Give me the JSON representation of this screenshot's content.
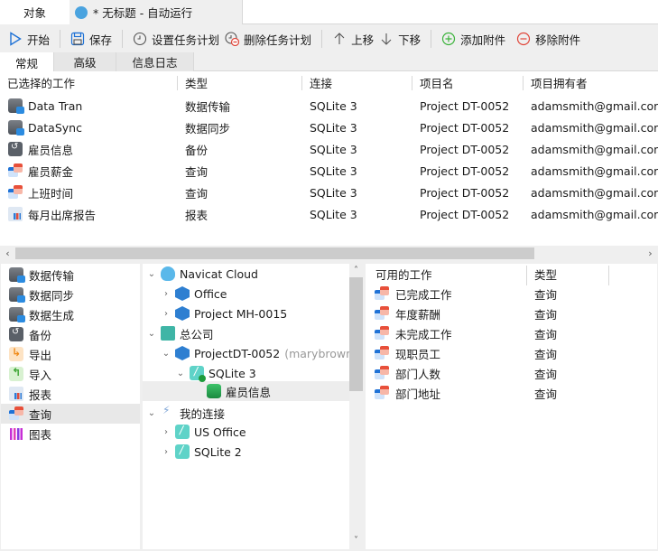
{
  "tabs": {
    "objects": "对象",
    "document": "* 无标题 - 自动运行"
  },
  "toolbar": {
    "start": "开始",
    "save": "保存",
    "set_schedule": "设置任务计划",
    "delete_schedule": "删除任务计划",
    "move_up": "上移",
    "move_down": "下移",
    "add_attachment": "添加附件",
    "remove_attachment": "移除附件"
  },
  "subtabs": [
    "常规",
    "高级",
    "信息日志"
  ],
  "selected_jobs": {
    "columns": [
      "已选择的工作",
      "类型",
      "连接",
      "项目名",
      "项目拥有者"
    ],
    "rows": [
      {
        "icon": "data-transfer-icon",
        "name": "Data Tran",
        "type": "数据传输",
        "connection": "SQLite 3",
        "project": "Project DT-0052",
        "owner": "adamsmith@gmail.com"
      },
      {
        "icon": "data-sync-icon",
        "name": "DataSync",
        "type": "数据同步",
        "connection": "SQLite 3",
        "project": "Project DT-0052",
        "owner": "adamsmith@gmail.com"
      },
      {
        "icon": "backup-icon",
        "name": "雇员信息",
        "type": "备份",
        "connection": "SQLite 3",
        "project": "Project DT-0052",
        "owner": "adamsmith@gmail.com"
      },
      {
        "icon": "query-icon",
        "name": "雇员薪金",
        "type": "查询",
        "connection": "SQLite 3",
        "project": "Project DT-0052",
        "owner": "adamsmith@gmail.com"
      },
      {
        "icon": "query-icon",
        "name": "上班时间",
        "type": "查询",
        "connection": "SQLite 3",
        "project": "Project DT-0052",
        "owner": "adamsmith@gmail.com"
      },
      {
        "icon": "report-icon",
        "name": "每月出席报告",
        "type": "报表",
        "connection": "SQLite 3",
        "project": "Project DT-0052",
        "owner": "adamsmith@gmail.com"
      }
    ]
  },
  "categories": [
    {
      "icon": "data-transfer-icon",
      "label": "数据传输"
    },
    {
      "icon": "data-sync-icon",
      "label": "数据同步"
    },
    {
      "icon": "data-generation-icon",
      "label": "数据生成"
    },
    {
      "icon": "backup-icon",
      "label": "备份"
    },
    {
      "icon": "export-icon",
      "label": "导出"
    },
    {
      "icon": "import-icon",
      "label": "导入"
    },
    {
      "icon": "report-icon",
      "label": "报表"
    },
    {
      "icon": "query-icon",
      "label": "查询",
      "selected": true
    },
    {
      "icon": "chart-icon",
      "label": "图表"
    }
  ],
  "tree": [
    {
      "label": "Navicat Cloud",
      "icon": "cloud-icon",
      "expanded": true,
      "level": 0
    },
    {
      "label": "Office",
      "icon": "project-icon",
      "expanded": false,
      "level": 1
    },
    {
      "label": "Project MH-0015",
      "icon": "team-project-icon",
      "expanded": false,
      "level": 1
    },
    {
      "label": "总公司",
      "icon": "headquarters-icon",
      "expanded": true,
      "level": 0
    },
    {
      "label": "ProjectDT-0052",
      "suffix": "(marybrown@",
      "icon": "team-project-icon",
      "expanded": true,
      "level": 1
    },
    {
      "label": "SQLite 3",
      "icon": "sqlite-connected-icon",
      "expanded": true,
      "level": 2
    },
    {
      "label": "雇员信息",
      "icon": "database-icon",
      "level": 3,
      "selected": true
    },
    {
      "label": "我的连接",
      "icon": "connection-plug-icon",
      "expanded": true,
      "level": 0
    },
    {
      "label": "US Office",
      "icon": "sqlite-icon",
      "expanded": false,
      "level": 1
    },
    {
      "label": "SQLite 2",
      "icon": "sqlite-icon",
      "expanded": false,
      "level": 1
    }
  ],
  "available_jobs": {
    "columns": [
      "可用的工作",
      "类型"
    ],
    "rows": [
      {
        "name": "已完成工作",
        "type": "查询"
      },
      {
        "name": "年度薪酬",
        "type": "查询"
      },
      {
        "name": "未完成工作",
        "type": "查询"
      },
      {
        "name": "现职员工",
        "type": "查询"
      },
      {
        "name": "部门人数",
        "type": "查询"
      },
      {
        "name": "部门地址",
        "type": "查询"
      }
    ]
  },
  "colors": {
    "accent_blue": "#1f72d6",
    "add_green": "#3bb33b",
    "remove_red": "#e0463a"
  }
}
